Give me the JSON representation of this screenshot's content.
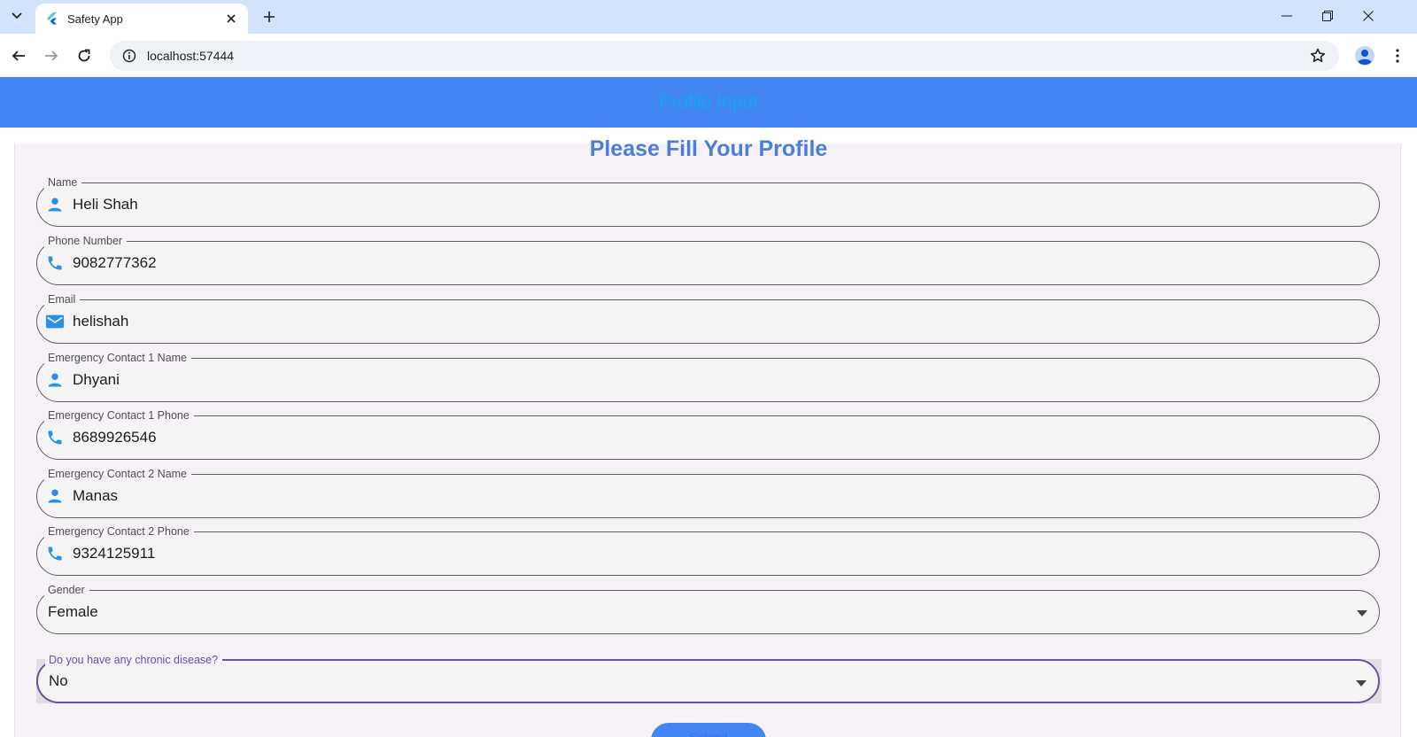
{
  "browser": {
    "tab_title": "Safety App",
    "url": "localhost:57444"
  },
  "app": {
    "title": "Profile Input"
  },
  "form": {
    "heading": "Please Fill Your Profile",
    "fields": [
      {
        "label": "Name",
        "value": "Heli Shah",
        "icon": "person-icon"
      },
      {
        "label": "Phone Number",
        "value": "9082777362",
        "icon": "phone-icon"
      },
      {
        "label": "Email",
        "value": "helishah",
        "icon": "email-icon"
      },
      {
        "label": "Emergency Contact 1 Name",
        "value": "Dhyani",
        "icon": "person-icon"
      },
      {
        "label": "Emergency Contact 1 Phone",
        "value": "8689926546",
        "icon": "phone-icon"
      },
      {
        "label": "Emergency Contact 2 Name",
        "value": "Manas",
        "icon": "person-icon"
      },
      {
        "label": "Emergency Contact 2 Phone",
        "value": "9324125911",
        "icon": "phone-icon"
      }
    ],
    "gender": {
      "label": "Gender",
      "value": "Female"
    },
    "chronic": {
      "label": "Do you have any chronic disease?",
      "value": "No"
    },
    "submit_label": "Submit"
  },
  "colors": {
    "appbar": "#4285f4",
    "app_title": "#16a4f5",
    "icon_blue": "#2a8fe6",
    "focus_purple": "#6b4fa8"
  }
}
